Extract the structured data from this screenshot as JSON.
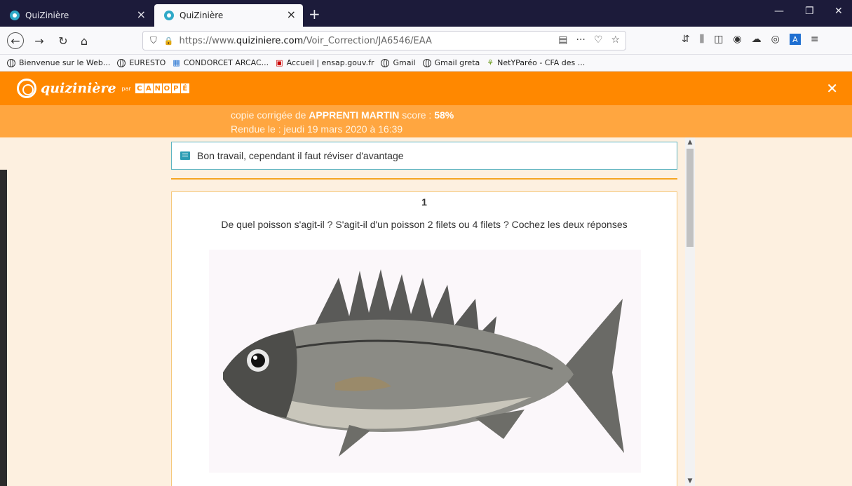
{
  "browser": {
    "tabs": [
      {
        "title": "QuiZinière",
        "active": false
      },
      {
        "title": "QuiZinière",
        "active": true
      }
    ],
    "url": {
      "prefix": "https://www.",
      "host": "quiziniere.com",
      "path": "/Voir_Correction/JA6546/EAA"
    },
    "bookmarks": [
      "Bienvenue sur le Web...",
      "EURESTO",
      "CONDORCET ARCAC...",
      "Accueil | ensap.gouv.fr",
      "Gmail",
      "Gmail greta",
      "NetYParéo - CFA des ..."
    ],
    "tools": {
      "a_label": "A"
    }
  },
  "app": {
    "logo_text": "quizinière",
    "logo_par": "par",
    "canope_letters": [
      "C",
      "A",
      "N",
      "O",
      "P",
      "É"
    ],
    "copy_prefix": "copie corrigée de ",
    "student": "APPRENTI MARTIN",
    "score_label": " score : ",
    "score": "58%",
    "returned": "Rendue le : jeudi 19 mars 2020 à 16:39",
    "feedback": "Bon travail, cependant il faut réviser d'avantage",
    "question": {
      "number": "1",
      "text": "De quel poisson s'agit-il ? S'agit-il d'un poisson 2 filets ou 4 filets ? Cochez les deux réponses"
    }
  },
  "colors": {
    "brand": "#ff8800",
    "subheader": "#ffa640",
    "accent": "#2d9db4"
  }
}
